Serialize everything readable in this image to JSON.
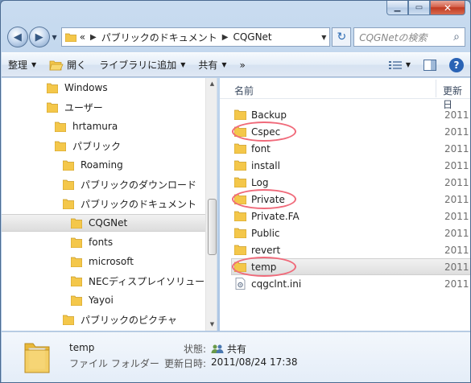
{
  "address": {
    "overflow": "«",
    "crumbs": [
      "パブリックのドキュメント",
      "CQGNet"
    ]
  },
  "search": {
    "placeholder": "CQGNetの検索"
  },
  "toolbar": {
    "organize": "整理",
    "open": "開く",
    "include_library": "ライブラリに追加",
    "share": "共有",
    "more": "»"
  },
  "tree": {
    "items": [
      {
        "label": "Windows"
      },
      {
        "label": "ユーザー"
      },
      {
        "label": "hrtamura"
      },
      {
        "label": "パブリック"
      },
      {
        "label": "Roaming"
      },
      {
        "label": "パブリックのダウンロード"
      },
      {
        "label": "パブリックのドキュメント"
      },
      {
        "label": "CQGNet"
      },
      {
        "label": "fonts"
      },
      {
        "label": "microsoft"
      },
      {
        "label": "NECディスプレイソリュー"
      },
      {
        "label": "Yayoi"
      },
      {
        "label": "パブリックのピクチャ"
      }
    ]
  },
  "files": {
    "col_name": "名前",
    "col_date": "更新日",
    "items": [
      {
        "name": "Backup",
        "date": "2011"
      },
      {
        "name": "Cspec",
        "date": "2011"
      },
      {
        "name": "font",
        "date": "2011"
      },
      {
        "name": "install",
        "date": "2011"
      },
      {
        "name": "Log",
        "date": "2011"
      },
      {
        "name": "Private",
        "date": "2011"
      },
      {
        "name": "Private.FA",
        "date": "2011"
      },
      {
        "name": "Public",
        "date": "2011"
      },
      {
        "name": "revert",
        "date": "2011"
      },
      {
        "name": "temp",
        "date": "2011"
      },
      {
        "name": "cqgclnt.ini",
        "date": "2011"
      }
    ]
  },
  "details": {
    "name": "temp",
    "type": "ファイル フォルダー",
    "state_label": "状態:",
    "state_value": "共有",
    "modified_label": "更新日時:",
    "modified_value": "2011/08/24 17:38"
  },
  "colors": {
    "annotation_circle": "#f06a7a",
    "folder": "#f4c74a"
  }
}
